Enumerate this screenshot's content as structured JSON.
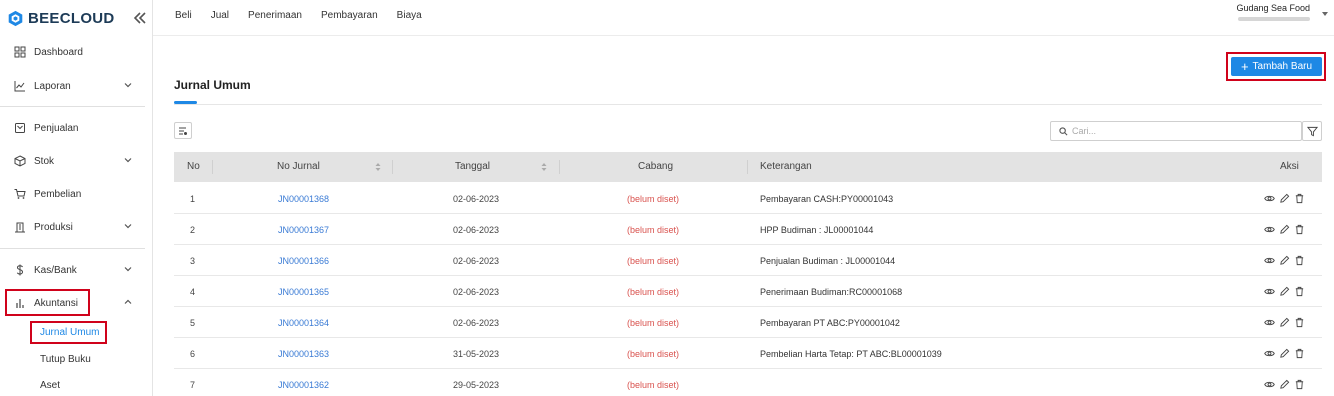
{
  "brand": {
    "name": "BEECLOUD"
  },
  "sidebar": {
    "items": [
      {
        "label": "Dashboard"
      },
      {
        "label": "Laporan"
      },
      {
        "label": "Penjualan"
      },
      {
        "label": "Stok"
      },
      {
        "label": "Pembelian"
      },
      {
        "label": "Produksi"
      },
      {
        "label": "Kas/Bank"
      },
      {
        "label": "Akuntansi"
      }
    ],
    "subitems": [
      {
        "label": "Jurnal Umum"
      },
      {
        "label": "Tutup Buku"
      },
      {
        "label": "Aset"
      }
    ]
  },
  "topnav": {
    "items": [
      "Beli",
      "Jual",
      "Penerimaan",
      "Pembayaran",
      "Biaya"
    ]
  },
  "company": {
    "name": "Gudang Sea Food"
  },
  "page": {
    "title": "Jurnal Umum",
    "add_button": "Tambah Baru",
    "search_placeholder": "Cari..."
  },
  "table": {
    "columns": [
      "No",
      "No Jurnal",
      "Tanggal",
      "Cabang",
      "Keterangan",
      "Aksi"
    ],
    "rows": [
      {
        "no": "1",
        "jurnal": "JN00001368",
        "tanggal": "02-06-2023",
        "cabang": "(belum diset)",
        "ket": "Pembayaran CASH:PY00001043"
      },
      {
        "no": "2",
        "jurnal": "JN00001367",
        "tanggal": "02-06-2023",
        "cabang": "(belum diset)",
        "ket": "HPP Budiman : JL00001044"
      },
      {
        "no": "3",
        "jurnal": "JN00001366",
        "tanggal": "02-06-2023",
        "cabang": "(belum diset)",
        "ket": "Penjualan Budiman : JL00001044"
      },
      {
        "no": "4",
        "jurnal": "JN00001365",
        "tanggal": "02-06-2023",
        "cabang": "(belum diset)",
        "ket": "Penerimaan Budiman:RC00001068"
      },
      {
        "no": "5",
        "jurnal": "JN00001364",
        "tanggal": "02-06-2023",
        "cabang": "(belum diset)",
        "ket": "Pembayaran PT ABC:PY00001042"
      },
      {
        "no": "6",
        "jurnal": "JN00001363",
        "tanggal": "31-05-2023",
        "cabang": "(belum diset)",
        "ket": "Pembelian Harta Tetap: PT ABC:BL00001039"
      },
      {
        "no": "7",
        "jurnal": "JN00001362",
        "tanggal": "29-05-2023",
        "cabang": "(belum diset)",
        "ket": ""
      }
    ]
  },
  "colors": {
    "accent": "#1e88e5",
    "link": "#3a7bd5",
    "warn": "#d9534f",
    "highlight": "#d0021b"
  }
}
